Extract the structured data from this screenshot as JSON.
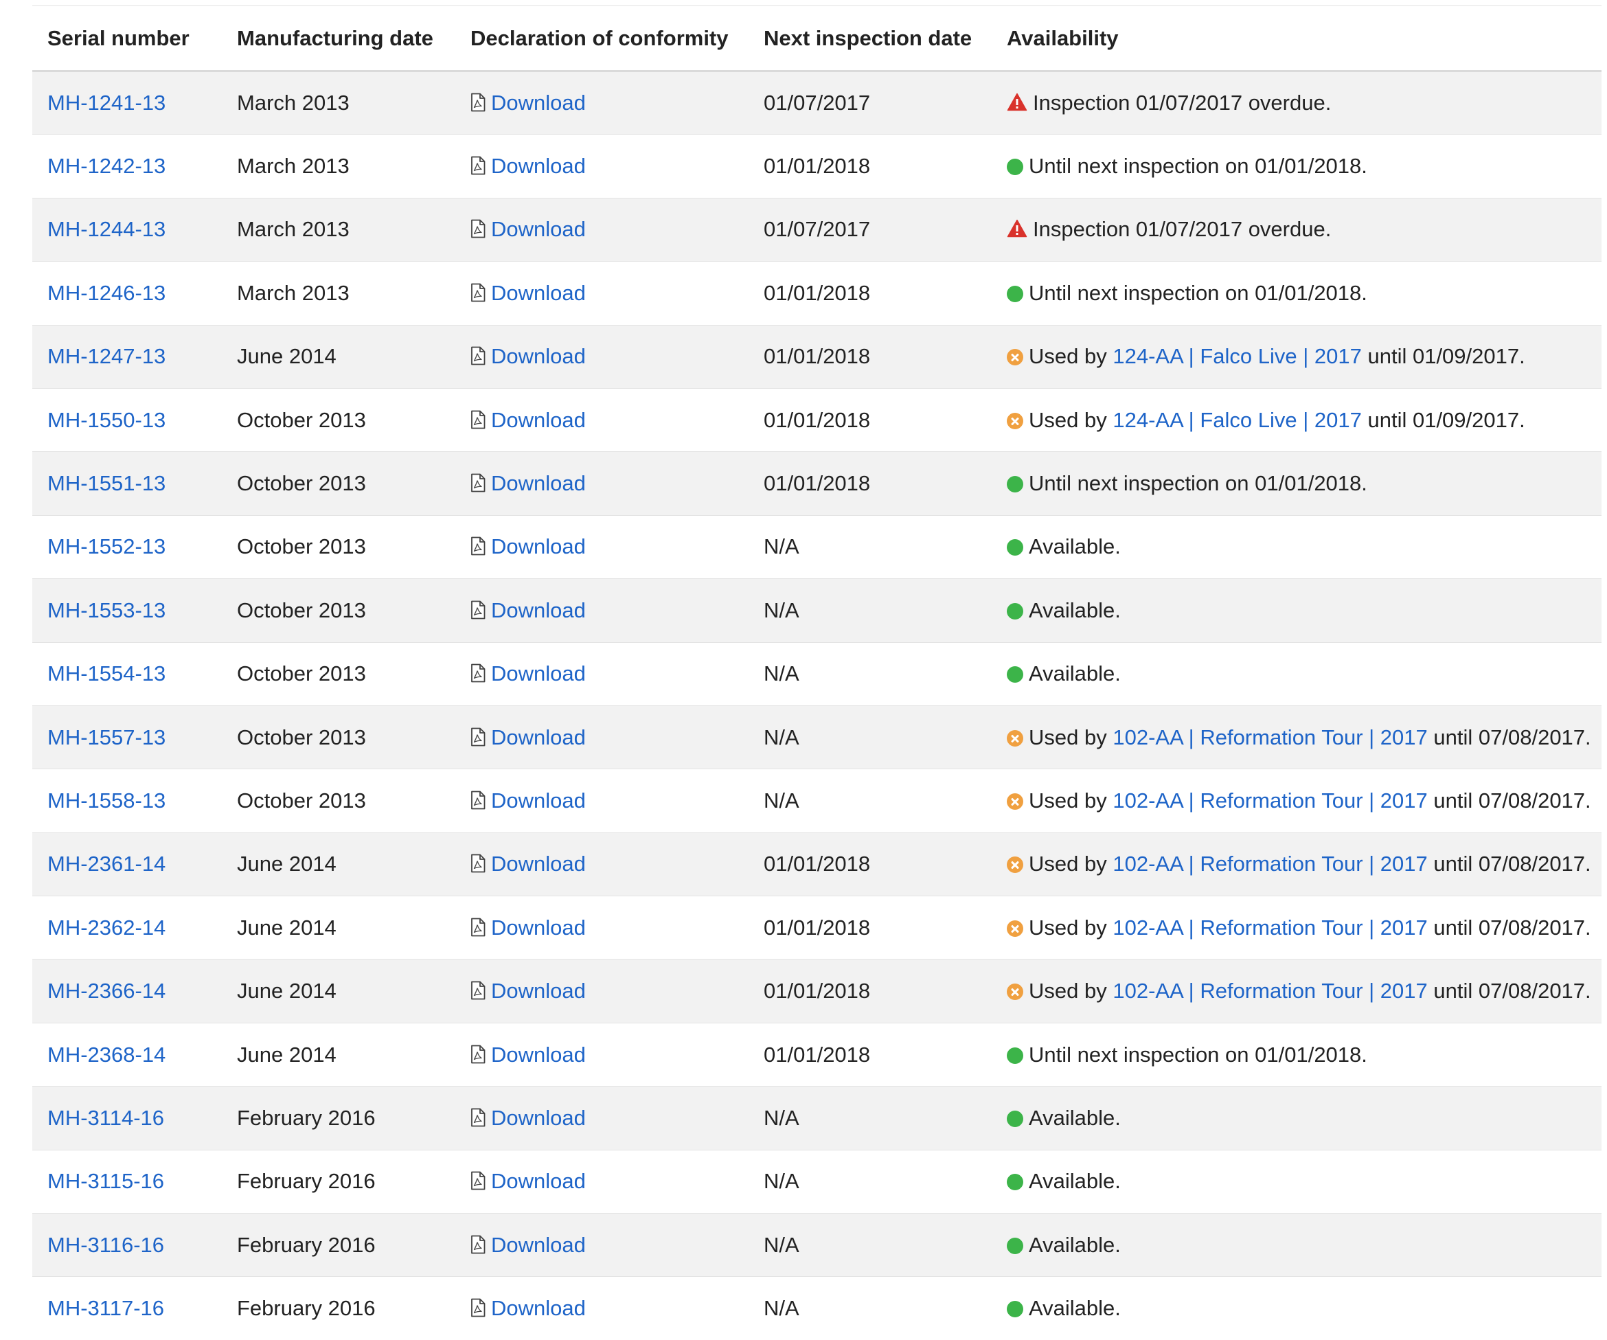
{
  "table": {
    "headers": {
      "serial": "Serial number",
      "manufacturing": "Manufacturing date",
      "declaration": "Declaration of conformity",
      "inspection": "Next inspection date",
      "availability": "Availability"
    },
    "rows": [
      {
        "serial": "MH-1241-13",
        "mfg": "March 2013",
        "doc": "Download",
        "inspection": "01/07/2017",
        "status": "warning",
        "text": "Inspection 01/07/2017 overdue."
      },
      {
        "serial": "MH-1242-13",
        "mfg": "March 2013",
        "doc": "Download",
        "inspection": "01/01/2018",
        "status": "ok",
        "text": "Until next inspection on 01/01/2018."
      },
      {
        "serial": "MH-1244-13",
        "mfg": "March 2013",
        "doc": "Download",
        "inspection": "01/07/2017",
        "status": "warning",
        "text": "Inspection 01/07/2017 overdue."
      },
      {
        "serial": "MH-1246-13",
        "mfg": "March 2013",
        "doc": "Download",
        "inspection": "01/01/2018",
        "status": "ok",
        "text": "Until next inspection on 01/01/2018."
      },
      {
        "serial": "MH-1247-13",
        "mfg": "June 2014",
        "doc": "Download",
        "inspection": "01/01/2018",
        "status": "used",
        "prefix": "Used by",
        "project": "124-AA | Falco Live | 2017",
        "suffix": "until 01/09/2017."
      },
      {
        "serial": "MH-1550-13",
        "mfg": "October 2013",
        "doc": "Download",
        "inspection": "01/01/2018",
        "status": "used",
        "prefix": "Used by",
        "project": "124-AA | Falco Live | 2017",
        "suffix": "until 01/09/2017."
      },
      {
        "serial": "MH-1551-13",
        "mfg": "October 2013",
        "doc": "Download",
        "inspection": "01/01/2018",
        "status": "ok",
        "text": "Until next inspection on 01/01/2018."
      },
      {
        "serial": "MH-1552-13",
        "mfg": "October 2013",
        "doc": "Download",
        "inspection": "N/A",
        "status": "ok",
        "text": "Available."
      },
      {
        "serial": "MH-1553-13",
        "mfg": "October 2013",
        "doc": "Download",
        "inspection": "N/A",
        "status": "ok",
        "text": "Available."
      },
      {
        "serial": "MH-1554-13",
        "mfg": "October 2013",
        "doc": "Download",
        "inspection": "N/A",
        "status": "ok",
        "text": "Available."
      },
      {
        "serial": "MH-1557-13",
        "mfg": "October 2013",
        "doc": "Download",
        "inspection": "N/A",
        "status": "used",
        "prefix": "Used by",
        "project": "102-AA | Reformation Tour | 2017",
        "suffix": "until 07/08/2017."
      },
      {
        "serial": "MH-1558-13",
        "mfg": "October 2013",
        "doc": "Download",
        "inspection": "N/A",
        "status": "used",
        "prefix": "Used by",
        "project": "102-AA | Reformation Tour | 2017",
        "suffix": "until 07/08/2017."
      },
      {
        "serial": "MH-2361-14",
        "mfg": "June 2014",
        "doc": "Download",
        "inspection": "01/01/2018",
        "status": "used",
        "prefix": "Used by",
        "project": "102-AA | Reformation Tour | 2017",
        "suffix": "until 07/08/2017."
      },
      {
        "serial": "MH-2362-14",
        "mfg": "June 2014",
        "doc": "Download",
        "inspection": "01/01/2018",
        "status": "used",
        "prefix": "Used by",
        "project": "102-AA | Reformation Tour | 2017",
        "suffix": "until 07/08/2017."
      },
      {
        "serial": "MH-2366-14",
        "mfg": "June 2014",
        "doc": "Download",
        "inspection": "01/01/2018",
        "status": "used",
        "prefix": "Used by",
        "project": "102-AA | Reformation Tour | 2017",
        "suffix": "until 07/08/2017."
      },
      {
        "serial": "MH-2368-14",
        "mfg": "June 2014",
        "doc": "Download",
        "inspection": "01/01/2018",
        "status": "ok",
        "text": "Until next inspection on 01/01/2018."
      },
      {
        "serial": "MH-3114-16",
        "mfg": "February 2016",
        "doc": "Download",
        "inspection": "N/A",
        "status": "ok",
        "text": "Available."
      },
      {
        "serial": "MH-3115-16",
        "mfg": "February 2016",
        "doc": "Download",
        "inspection": "N/A",
        "status": "ok",
        "text": "Available."
      },
      {
        "serial": "MH-3116-16",
        "mfg": "February 2016",
        "doc": "Download",
        "inspection": "N/A",
        "status": "ok",
        "text": "Available."
      },
      {
        "serial": "MH-3117-16",
        "mfg": "February 2016",
        "doc": "Download",
        "inspection": "N/A",
        "status": "ok",
        "text": "Available."
      }
    ]
  },
  "icons": {
    "document": "pdf-document-icon",
    "ok": "green-status-dot-icon",
    "used": "orange-x-circle-icon",
    "warning": "warning-triangle-icon"
  },
  "colors": {
    "link": "#1e64c8",
    "ok": "#3cb449",
    "used": "#f0a040",
    "warning": "#d9322b",
    "stripe": "#f2f2f2"
  }
}
